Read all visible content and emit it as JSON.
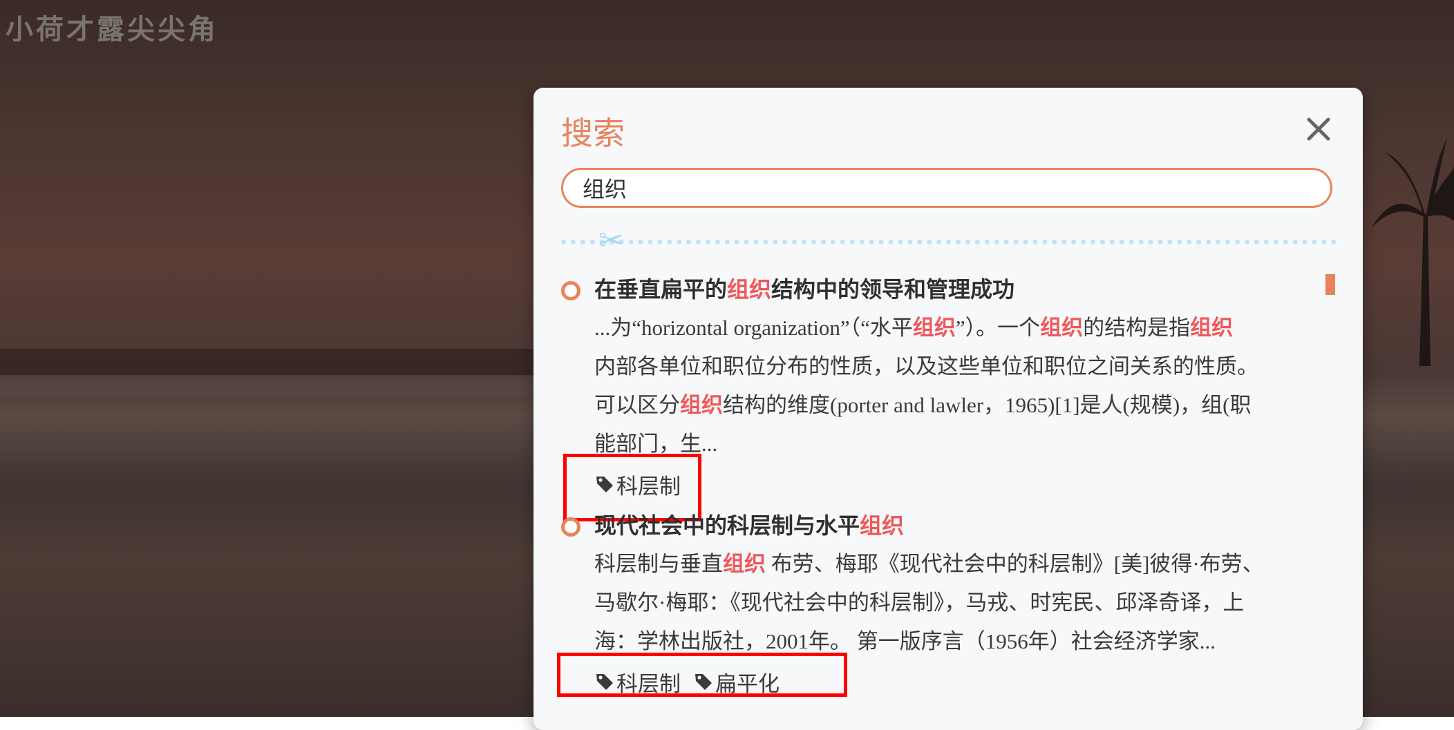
{
  "site": {
    "title": "小荷才露尖尖角"
  },
  "search_modal": {
    "title": "搜索",
    "query": "组织",
    "results": [
      {
        "title_parts": [
          "在垂直扁平的",
          "组织",
          "结构中的领导和管理成功"
        ],
        "snippet_lines": [
          [
            "...为“horizontal organization”（“水平",
            "组织",
            "”）。一个",
            "组织",
            "的结构是指",
            "组织"
          ],
          [
            "内部各单位和职位分布的性质，以及这些单位和职位之间关系的性质。"
          ],
          [
            "可以区分",
            "组织",
            "结构的维度(porter and lawler，1965)[1]是人(规模)，组(职"
          ],
          [
            "能部门，生..."
          ]
        ],
        "tags": [
          "科层制"
        ]
      },
      {
        "title_parts": [
          "现代社会中的科层制与水平",
          "组织"
        ],
        "snippet_lines": [
          [
            "科层制与垂直",
            "组织",
            " 布劳、梅耶《现代社会中的科层制》[美]彼得·布劳、"
          ],
          [
            "马歇尔·梅耶：《现代社会中的科层制》，马戎、时宪民、邱泽奇译，上"
          ],
          [
            "海：学林出版社，2001年。 第一版序言（1956年）社会经济学家..."
          ]
        ],
        "tags": [
          "科层制",
          "扁平化"
        ]
      }
    ]
  },
  "colors": {
    "accent": "#e8845b",
    "highlight": "#f0575a",
    "annotation_box": "#ff0000"
  }
}
